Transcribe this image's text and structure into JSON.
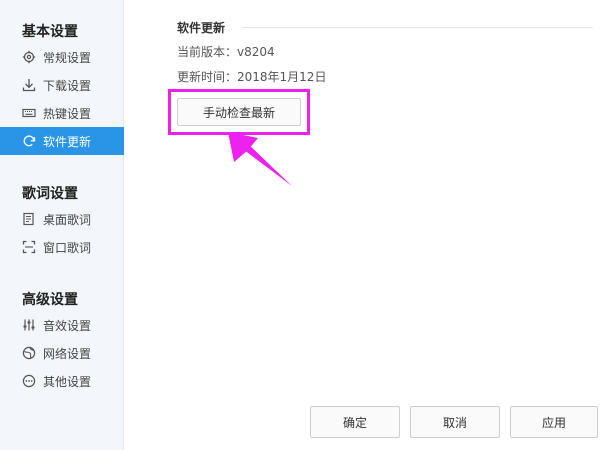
{
  "sidebar": {
    "sections": [
      {
        "title": "基本设置",
        "items": [
          {
            "label": "常规设置",
            "icon": "gear-icon"
          },
          {
            "label": "下载设置",
            "icon": "download-icon"
          },
          {
            "label": "热键设置",
            "icon": "keyboard-icon"
          },
          {
            "label": "软件更新",
            "icon": "refresh-icon",
            "active": true
          }
        ]
      },
      {
        "title": "歌词设置",
        "items": [
          {
            "label": "桌面歌词",
            "icon": "desktop-lyrics-icon"
          },
          {
            "label": "窗口歌词",
            "icon": "window-lyrics-icon"
          }
        ]
      },
      {
        "title": "高级设置",
        "items": [
          {
            "label": "音效设置",
            "icon": "equalizer-icon"
          },
          {
            "label": "网络设置",
            "icon": "network-icon"
          },
          {
            "label": "其他设置",
            "icon": "more-icon"
          }
        ]
      }
    ]
  },
  "update": {
    "title": "软件更新",
    "current_version": "当前版本：v8204",
    "update_time": "更新时间：2018年1月12日",
    "check_button": "手动检查最新"
  },
  "footer": {
    "ok": "确定",
    "cancel": "取消",
    "apply": "应用"
  },
  "colors": {
    "accent": "#2a94e6",
    "highlight": "#ee22ee"
  }
}
